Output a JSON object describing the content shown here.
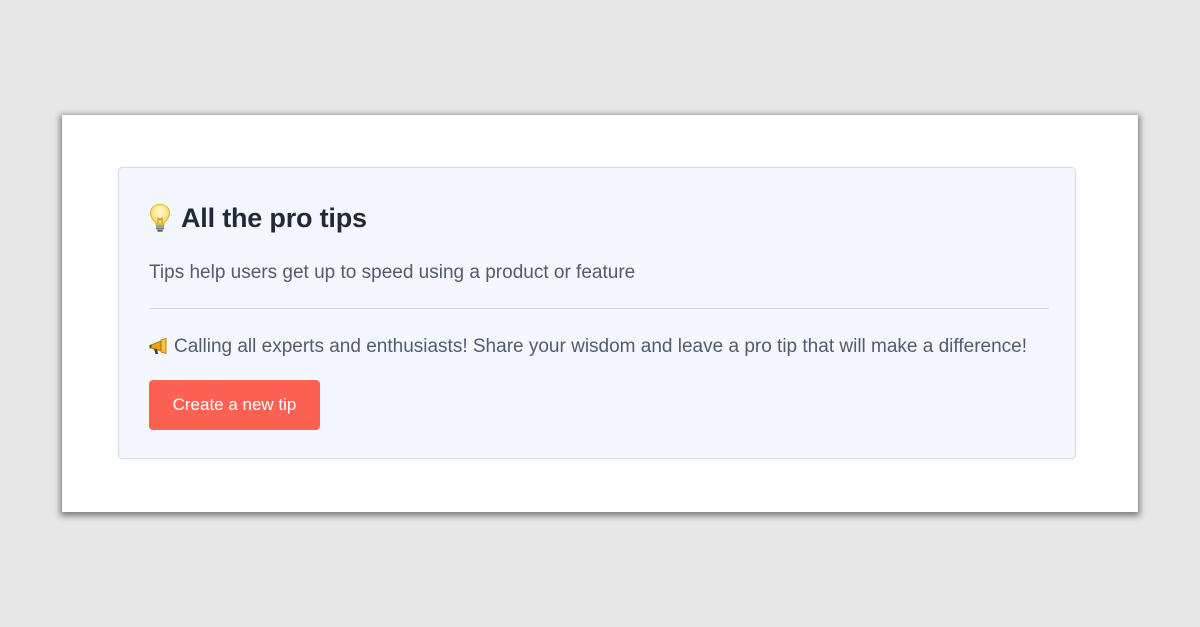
{
  "card": {
    "title_icon": "lightbulb-icon",
    "title": "All the pro tips",
    "subtitle": "Tips help users get up to speed using a product or feature",
    "callout_icon": "megaphone-icon",
    "callout": "Calling all experts and enthusiasts! Share your wisdom and leave a pro tip that will make a difference!",
    "button_label": "Create a new tip"
  },
  "colors": {
    "page_background": "#e7e7e7",
    "card_background": "#f4f7fd",
    "button": "#fd6154",
    "title_text": "#1f2937",
    "body_text": "#505c70"
  }
}
